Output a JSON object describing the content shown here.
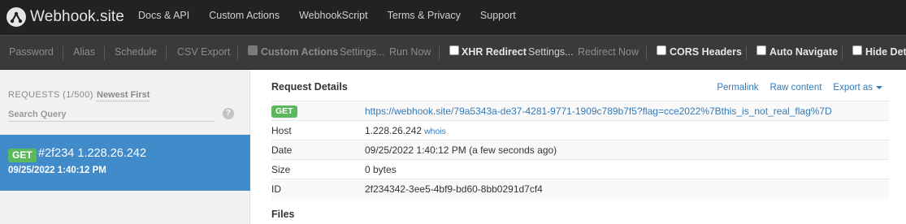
{
  "brand": {
    "name": "Webhook.site"
  },
  "nav": [
    "Docs & API",
    "Custom Actions",
    "WebhookScript",
    "Terms & Privacy",
    "Support"
  ],
  "toolbar": {
    "password": "Password",
    "alias": "Alias",
    "schedule": "Schedule",
    "csv_export": "CSV Export",
    "custom_actions": "Custom Actions",
    "settings1": "Settings...",
    "run_now": "Run Now",
    "xhr_redirect": "XHR Redirect",
    "settings2": "Settings...",
    "redirect_now": "Redirect Now",
    "cors_headers": "CORS Headers",
    "auto_navigate": "Auto Navigate",
    "hide_details": "Hide Details"
  },
  "sidebar": {
    "requests_count": "REQUESTS (1/500)",
    "sort": "Newest First",
    "search_placeholder": "Search Query",
    "help": "?",
    "requests": [
      {
        "method": "GET",
        "title": "#2f234 1.228.26.242",
        "date": "09/25/2022 1:40:12 PM"
      }
    ]
  },
  "main": {
    "title": "Request Details",
    "actions": {
      "permalink": "Permalink",
      "raw": "Raw content",
      "export": "Export as"
    },
    "method": "GET",
    "url": "https://webhook.site/79a5343a-de37-4281-9771-1909c789b7f5?flag=cce2022%7Bthis_is_not_real_flag%7D",
    "rows": [
      {
        "key": "Host",
        "value": "1.228.26.242",
        "extra": "whois"
      },
      {
        "key": "Date",
        "value": "09/25/2022 1:40:12 PM (a few seconds ago)"
      },
      {
        "key": "Size",
        "value": "0 bytes"
      },
      {
        "key": "ID",
        "value": "2f234342-3ee5-4bf9-bd60-8bb0291d7cf4"
      }
    ],
    "files_title": "Files"
  },
  "colors": {
    "navbar": "#222222",
    "toolbar": "#3a3a3a",
    "accent": "#428bca",
    "badge": "#5cb85c",
    "link": "#337ab7"
  }
}
